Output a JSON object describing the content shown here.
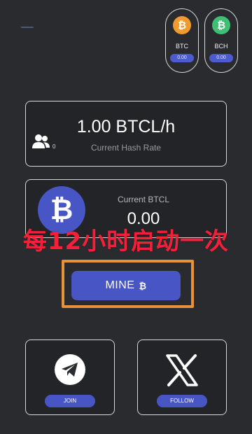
{
  "coins": {
    "btc": {
      "label": "BTC",
      "value": "0.00",
      "symbol": "₿",
      "color": "#f19a2e"
    },
    "bch": {
      "label": "BCH",
      "value": "0.00",
      "symbol": "₿",
      "color": "#3fbf74"
    }
  },
  "hash_rate": {
    "value": "1.00 BTCL/h",
    "label": "Current Hash Rate",
    "users_count": "0"
  },
  "balance": {
    "label": "Current BTCL",
    "value": "0.00",
    "symbol": "₿"
  },
  "overlay": {
    "text": "每12小时启动一次",
    "color": "#ff1f3a"
  },
  "mine": {
    "label": "MINE",
    "symbol": "₿",
    "frame_color": "#e7923a",
    "button_color": "#4855c4"
  },
  "social": {
    "telegram": {
      "label": "JOIN",
      "icon": "telegram-icon"
    },
    "x": {
      "label": "FOLLOW",
      "icon": "x-logo-icon"
    }
  }
}
